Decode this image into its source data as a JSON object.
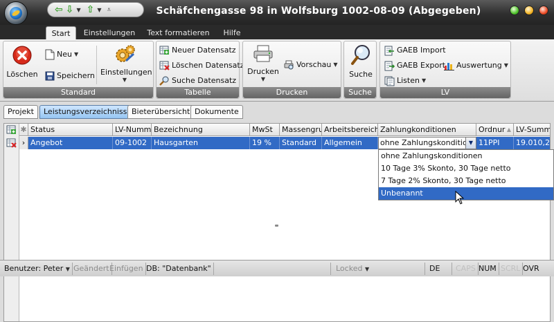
{
  "window": {
    "title": "Schäfchengasse 98 in Wolfsburg 1002-08-09 (Abgegeben)"
  },
  "ribbon_tabs": [
    "Start",
    "Einstellungen",
    "Text formatieren",
    "Hilfe"
  ],
  "ribbon": {
    "standard": {
      "label": "Standard",
      "loeschen": "Löschen",
      "neu": "Neu",
      "speichern": "Speichern",
      "einstellungen": "Einstellungen"
    },
    "tabelle": {
      "label": "Tabelle",
      "neuer_datensatz": "Neuer Datensatz",
      "loeschen_datensatz": "Löschen Datensatz",
      "suche_datensatz": "Suche Datensatz"
    },
    "drucken": {
      "label": "Drucken",
      "drucken": "Drucken",
      "vorschau": "Vorschau"
    },
    "suche": {
      "label": "Suche",
      "suche": "Suche"
    },
    "lv": {
      "label": "LV",
      "gaeb_import": "GAEB Import",
      "gaeb_export": "GAEB Export",
      "auswertung": "Auswertung",
      "listen": "Listen"
    }
  },
  "doc_tabs": [
    "Projekt",
    "Leistungsverzeichnisse",
    "Bieterübersicht",
    "Dokumente"
  ],
  "grid": {
    "headers": [
      "Status",
      "LV-Nummer",
      "Bezeichnung",
      "MwSt",
      "Massengrup",
      "Arbeitsbereich",
      "Zahlungkonditionen",
      "Ordnur",
      "LV-Summe"
    ],
    "row": [
      "Angebot",
      "09-1002",
      "Hausgarten",
      "19 %",
      "Standard",
      "Allgemein",
      "ohne Zahlungskonditionen",
      "11PPI",
      "19.010,2"
    ]
  },
  "dropdown_options": [
    "ohne Zahlungskonditionen",
    "10 Tage 3% Skonto, 30 Tage netto",
    "7 Tage 2% Skonto, 30 Tage netto",
    "Unbenannt"
  ],
  "status_bar": {
    "benutzer": "Benutzer: Peter",
    "geaendert": "Geändert",
    "einfuegen": "Einfügen",
    "db": "DB: \"Datenbank\"",
    "locked": "Locked",
    "lang": "DE",
    "caps": "CAPS",
    "num": "NUM",
    "scrl": "SCRL",
    "ovr": "OVR"
  },
  "colors": {
    "selection": "#316ac5",
    "active_doc_tab": "#96c6f3",
    "title_bar": "#2f2f2f"
  }
}
